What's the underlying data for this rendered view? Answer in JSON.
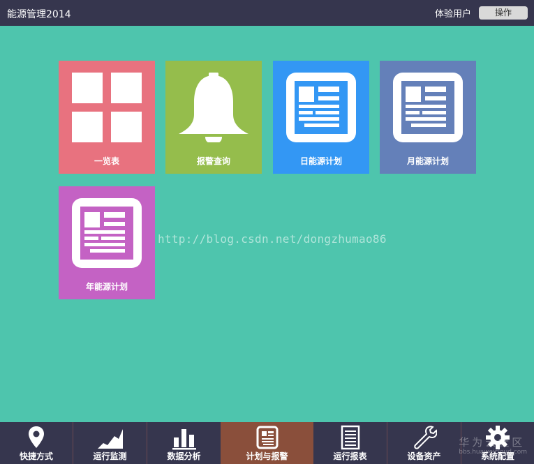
{
  "window": {
    "title": "能源管理2014",
    "user_label": "体验用户",
    "action_button": "操作"
  },
  "tiles": [
    {
      "label": "一览表",
      "icon": "grid-icon",
      "color": "#e8727f"
    },
    {
      "label": "报警查询",
      "icon": "bell-icon",
      "color": "#95bd4c"
    },
    {
      "label": "日能源计划",
      "icon": "document-icon",
      "color": "#3397f4"
    },
    {
      "label": "月能源计划",
      "icon": "document-icon",
      "color": "#6480b9"
    },
    {
      "label": "年能源计划",
      "icon": "document-icon",
      "color": "#c462c4"
    }
  ],
  "watermark": "http://blog.csdn.net/dongzhumao86",
  "bottom_nav": {
    "active_index": 3,
    "items": [
      {
        "label": "快捷方式",
        "icon": "location-pin-icon"
      },
      {
        "label": "运行监测",
        "icon": "area-chart-icon"
      },
      {
        "label": "数据分析",
        "icon": "bar-chart-icon"
      },
      {
        "label": "计划与报警",
        "icon": "document-icon"
      },
      {
        "label": "运行报表",
        "icon": "report-icon"
      },
      {
        "label": "设备资产",
        "icon": "wrench-icon"
      },
      {
        "label": "系统配置",
        "icon": "gear-icon"
      }
    ]
  },
  "corner_watermark": {
    "text": "华为云社区",
    "url": "bbs.huaweicloud.com"
  },
  "colors": {
    "background": "#4ec5ad",
    "bar": "#36364e",
    "active_nav": "#8a4f3b"
  }
}
